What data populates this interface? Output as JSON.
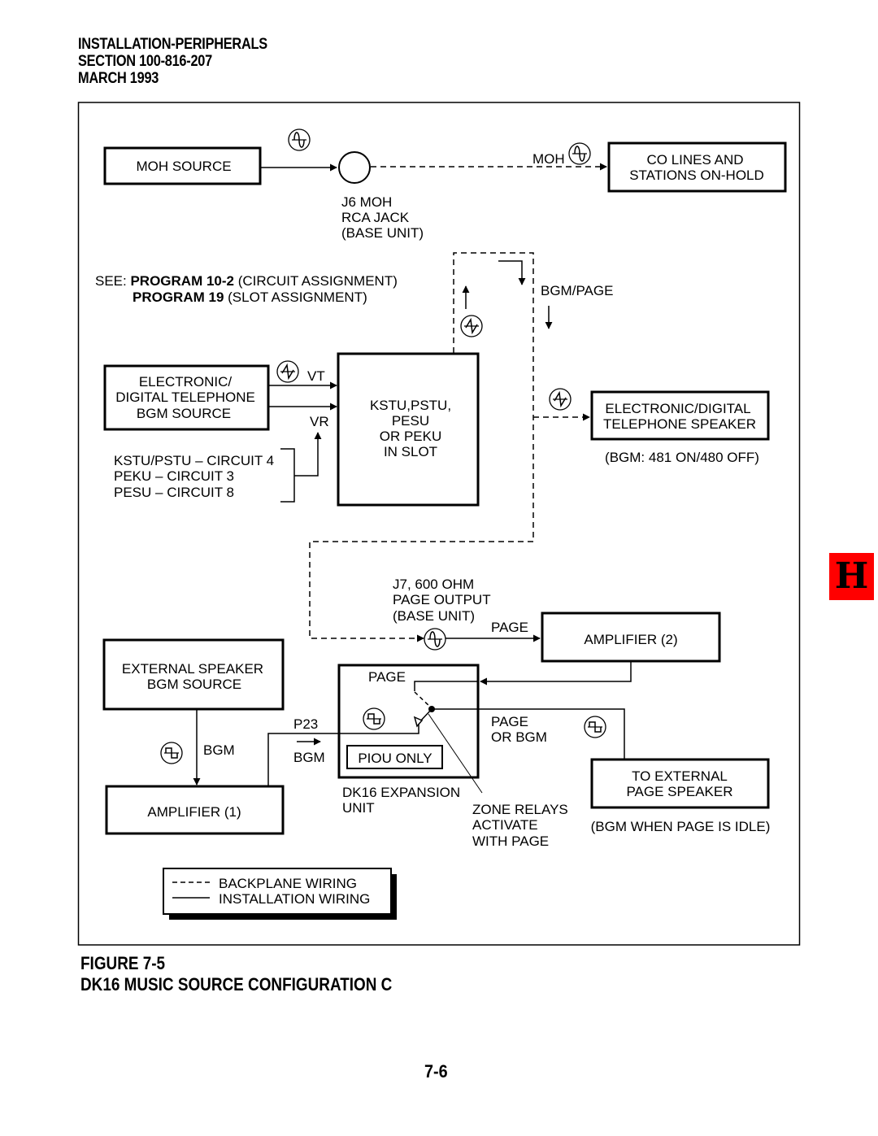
{
  "header": {
    "line1": "INSTALLATION-PERIPHERALS",
    "line2": "SECTION 100-816-207",
    "line3": "MARCH 1993"
  },
  "diagram": {
    "boxes": {
      "moh_source": "MOH SOURCE",
      "co_lines": [
        "CO LINES AND",
        "STATIONS ON-HOLD"
      ],
      "bgm_source": [
        "ELECTRONIC/",
        "DIGITAL TELEPHONE",
        "BGM SOURCE"
      ],
      "kstu": [
        "KSTU,PSTU,",
        "PESU",
        "OR PEKU",
        "IN SLOT"
      ],
      "speaker": [
        "ELECTRONIC/DIGITAL",
        "TELEPHONE SPEAKER"
      ],
      "amp2": "AMPLIFIER (2)",
      "ext_bgm_source": [
        "EXTERNAL SPEAKER",
        "BGM SOURCE"
      ],
      "amp1": "AMPLIFIER (1)",
      "ext_page_speaker": [
        "TO EXTERNAL",
        "PAGE SPEAKER"
      ],
      "piou": "PIOU ONLY"
    },
    "labels": {
      "moh": "MOH",
      "j6": [
        "J6 MOH",
        "RCA JACK",
        "(BASE UNIT)"
      ],
      "see_prefix": "SEE: ",
      "prog1_bold": "PROGRAM 10-2",
      "prog1_rest": " (CIRCUIT ASSIGNMENT)",
      "prog2_bold": "PROGRAM 19",
      "prog2_rest": " (SLOT ASSIGNMENT)",
      "bgm_page": "BGM/PAGE",
      "vt": "VT",
      "vr": "VR",
      "circuits": [
        "KSTU/PSTU – CIRCUIT 4",
        "PEKU – CIRCUIT 3",
        "PESU – CIRCUIT 8"
      ],
      "bgm_setting": "(BGM: 481 ON/480 OFF)",
      "j7": [
        "J7, 600 OHM",
        "PAGE OUTPUT",
        "(BASE UNIT)"
      ],
      "page_amp": "PAGE",
      "page_in": "PAGE",
      "p23": "P23",
      "bgm_p23": "BGM",
      "bgm_vertical": "BGM",
      "page_or_bgm": [
        "PAGE",
        "OR BGM"
      ],
      "dk16": [
        "DK16 EXPANSION",
        "UNIT"
      ],
      "zone_relays": [
        "ZONE RELAYS",
        "ACTIVATE",
        "WITH PAGE"
      ],
      "bgm_idle": "(BGM WHEN PAGE IS IDLE)"
    },
    "legend": {
      "backplane": "BACKPLANE WIRING",
      "installation": "INSTALLATION WIRING"
    },
    "icons": {
      "sine": "sine-wave-icon",
      "sawtooth": "sawtooth-wave-icon",
      "square": "square-wave-icon"
    }
  },
  "caption": {
    "line1": "FIGURE 7-5",
    "line2": "DK16 MUSIC SOURCE CONFIGURATION C"
  },
  "page_number": "7-6",
  "section_tab": {
    "letter": "H",
    "color": "#ff0000"
  }
}
